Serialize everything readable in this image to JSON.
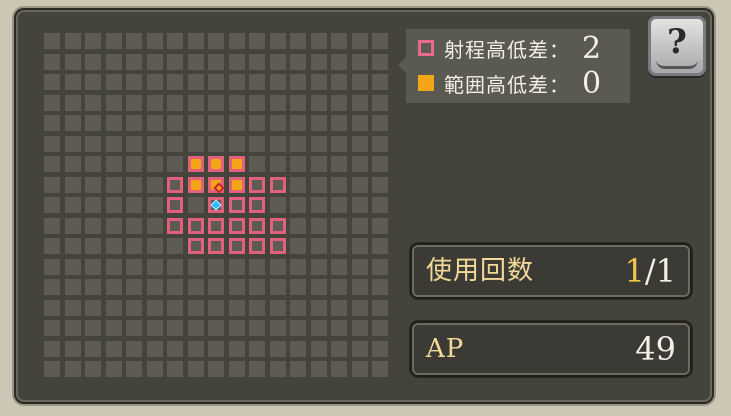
{
  "legend": {
    "range_label": "射程高低差：",
    "range_value": "2",
    "area_label": "範囲高低差：",
    "area_value": "0",
    "colors": {
      "range": "#e56b89",
      "area": "#f3a515"
    }
  },
  "help_button": {
    "label": "?",
    "icon": "help-book-icon"
  },
  "usage": {
    "label": "使用回数",
    "used": "1",
    "separator": "/",
    "max": "1"
  },
  "ap": {
    "label": "AP",
    "value": "49"
  },
  "grid": {
    "columns": 17,
    "rows": 17,
    "range_cells": [
      [
        6,
        7
      ],
      [
        6,
        8
      ],
      [
        6,
        9
      ],
      [
        7,
        7
      ],
      [
        7,
        9
      ],
      [
        7,
        10
      ],
      [
        8,
        7
      ],
      [
        8,
        8
      ],
      [
        8,
        9
      ],
      [
        8,
        10
      ],
      [
        9,
        7
      ],
      [
        9,
        8
      ],
      [
        9,
        9
      ],
      [
        9,
        10
      ],
      [
        10,
        7
      ],
      [
        10,
        8
      ],
      [
        10,
        9
      ],
      [
        10,
        10
      ],
      [
        11,
        7
      ],
      [
        11,
        9
      ],
      [
        11,
        10
      ]
    ],
    "area_cells": [
      [
        7,
        6
      ],
      [
        8,
        6
      ],
      [
        9,
        6
      ],
      [
        7,
        7
      ],
      [
        8,
        7
      ],
      [
        9,
        7
      ]
    ],
    "target_cell": [
      8,
      7
    ],
    "origin_cell": [
      8,
      8
    ]
  }
}
